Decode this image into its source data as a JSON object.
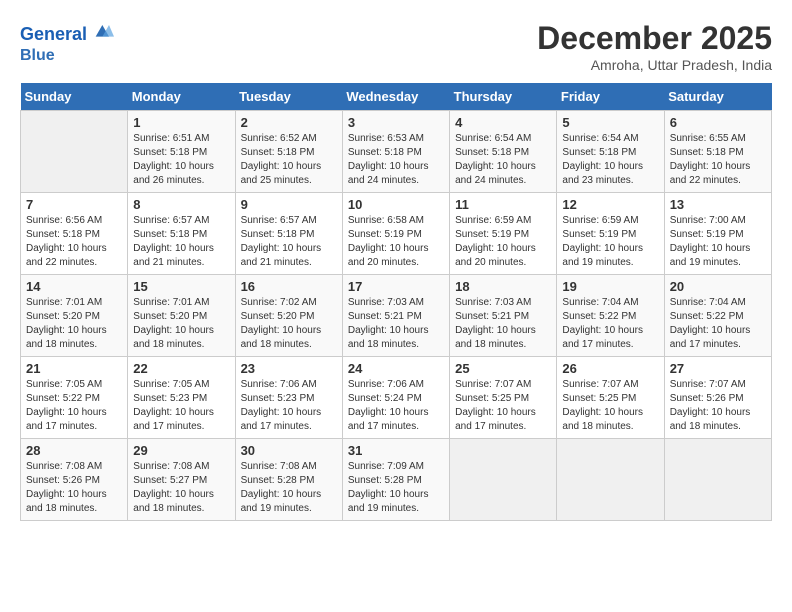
{
  "header": {
    "logo_line1": "General",
    "logo_line2": "Blue",
    "month": "December 2025",
    "location": "Amroha, Uttar Pradesh, India"
  },
  "weekdays": [
    "Sunday",
    "Monday",
    "Tuesday",
    "Wednesday",
    "Thursday",
    "Friday",
    "Saturday"
  ],
  "weeks": [
    [
      {
        "day": "",
        "sunrise": "",
        "sunset": "",
        "daylight": ""
      },
      {
        "day": "1",
        "sunrise": "Sunrise: 6:51 AM",
        "sunset": "Sunset: 5:18 PM",
        "daylight": "Daylight: 10 hours and 26 minutes."
      },
      {
        "day": "2",
        "sunrise": "Sunrise: 6:52 AM",
        "sunset": "Sunset: 5:18 PM",
        "daylight": "Daylight: 10 hours and 25 minutes."
      },
      {
        "day": "3",
        "sunrise": "Sunrise: 6:53 AM",
        "sunset": "Sunset: 5:18 PM",
        "daylight": "Daylight: 10 hours and 24 minutes."
      },
      {
        "day": "4",
        "sunrise": "Sunrise: 6:54 AM",
        "sunset": "Sunset: 5:18 PM",
        "daylight": "Daylight: 10 hours and 24 minutes."
      },
      {
        "day": "5",
        "sunrise": "Sunrise: 6:54 AM",
        "sunset": "Sunset: 5:18 PM",
        "daylight": "Daylight: 10 hours and 23 minutes."
      },
      {
        "day": "6",
        "sunrise": "Sunrise: 6:55 AM",
        "sunset": "Sunset: 5:18 PM",
        "daylight": "Daylight: 10 hours and 22 minutes."
      }
    ],
    [
      {
        "day": "7",
        "sunrise": "Sunrise: 6:56 AM",
        "sunset": "Sunset: 5:18 PM",
        "daylight": "Daylight: 10 hours and 22 minutes."
      },
      {
        "day": "8",
        "sunrise": "Sunrise: 6:57 AM",
        "sunset": "Sunset: 5:18 PM",
        "daylight": "Daylight: 10 hours and 21 minutes."
      },
      {
        "day": "9",
        "sunrise": "Sunrise: 6:57 AM",
        "sunset": "Sunset: 5:18 PM",
        "daylight": "Daylight: 10 hours and 21 minutes."
      },
      {
        "day": "10",
        "sunrise": "Sunrise: 6:58 AM",
        "sunset": "Sunset: 5:19 PM",
        "daylight": "Daylight: 10 hours and 20 minutes."
      },
      {
        "day": "11",
        "sunrise": "Sunrise: 6:59 AM",
        "sunset": "Sunset: 5:19 PM",
        "daylight": "Daylight: 10 hours and 20 minutes."
      },
      {
        "day": "12",
        "sunrise": "Sunrise: 6:59 AM",
        "sunset": "Sunset: 5:19 PM",
        "daylight": "Daylight: 10 hours and 19 minutes."
      },
      {
        "day": "13",
        "sunrise": "Sunrise: 7:00 AM",
        "sunset": "Sunset: 5:19 PM",
        "daylight": "Daylight: 10 hours and 19 minutes."
      }
    ],
    [
      {
        "day": "14",
        "sunrise": "Sunrise: 7:01 AM",
        "sunset": "Sunset: 5:20 PM",
        "daylight": "Daylight: 10 hours and 18 minutes."
      },
      {
        "day": "15",
        "sunrise": "Sunrise: 7:01 AM",
        "sunset": "Sunset: 5:20 PM",
        "daylight": "Daylight: 10 hours and 18 minutes."
      },
      {
        "day": "16",
        "sunrise": "Sunrise: 7:02 AM",
        "sunset": "Sunset: 5:20 PM",
        "daylight": "Daylight: 10 hours and 18 minutes."
      },
      {
        "day": "17",
        "sunrise": "Sunrise: 7:03 AM",
        "sunset": "Sunset: 5:21 PM",
        "daylight": "Daylight: 10 hours and 18 minutes."
      },
      {
        "day": "18",
        "sunrise": "Sunrise: 7:03 AM",
        "sunset": "Sunset: 5:21 PM",
        "daylight": "Daylight: 10 hours and 18 minutes."
      },
      {
        "day": "19",
        "sunrise": "Sunrise: 7:04 AM",
        "sunset": "Sunset: 5:22 PM",
        "daylight": "Daylight: 10 hours and 17 minutes."
      },
      {
        "day": "20",
        "sunrise": "Sunrise: 7:04 AM",
        "sunset": "Sunset: 5:22 PM",
        "daylight": "Daylight: 10 hours and 17 minutes."
      }
    ],
    [
      {
        "day": "21",
        "sunrise": "Sunrise: 7:05 AM",
        "sunset": "Sunset: 5:22 PM",
        "daylight": "Daylight: 10 hours and 17 minutes."
      },
      {
        "day": "22",
        "sunrise": "Sunrise: 7:05 AM",
        "sunset": "Sunset: 5:23 PM",
        "daylight": "Daylight: 10 hours and 17 minutes."
      },
      {
        "day": "23",
        "sunrise": "Sunrise: 7:06 AM",
        "sunset": "Sunset: 5:23 PM",
        "daylight": "Daylight: 10 hours and 17 minutes."
      },
      {
        "day": "24",
        "sunrise": "Sunrise: 7:06 AM",
        "sunset": "Sunset: 5:24 PM",
        "daylight": "Daylight: 10 hours and 17 minutes."
      },
      {
        "day": "25",
        "sunrise": "Sunrise: 7:07 AM",
        "sunset": "Sunset: 5:25 PM",
        "daylight": "Daylight: 10 hours and 17 minutes."
      },
      {
        "day": "26",
        "sunrise": "Sunrise: 7:07 AM",
        "sunset": "Sunset: 5:25 PM",
        "daylight": "Daylight: 10 hours and 18 minutes."
      },
      {
        "day": "27",
        "sunrise": "Sunrise: 7:07 AM",
        "sunset": "Sunset: 5:26 PM",
        "daylight": "Daylight: 10 hours and 18 minutes."
      }
    ],
    [
      {
        "day": "28",
        "sunrise": "Sunrise: 7:08 AM",
        "sunset": "Sunset: 5:26 PM",
        "daylight": "Daylight: 10 hours and 18 minutes."
      },
      {
        "day": "29",
        "sunrise": "Sunrise: 7:08 AM",
        "sunset": "Sunset: 5:27 PM",
        "daylight": "Daylight: 10 hours and 18 minutes."
      },
      {
        "day": "30",
        "sunrise": "Sunrise: 7:08 AM",
        "sunset": "Sunset: 5:28 PM",
        "daylight": "Daylight: 10 hours and 19 minutes."
      },
      {
        "day": "31",
        "sunrise": "Sunrise: 7:09 AM",
        "sunset": "Sunset: 5:28 PM",
        "daylight": "Daylight: 10 hours and 19 minutes."
      },
      {
        "day": "",
        "sunrise": "",
        "sunset": "",
        "daylight": ""
      },
      {
        "day": "",
        "sunrise": "",
        "sunset": "",
        "daylight": ""
      },
      {
        "day": "",
        "sunrise": "",
        "sunset": "",
        "daylight": ""
      }
    ]
  ]
}
